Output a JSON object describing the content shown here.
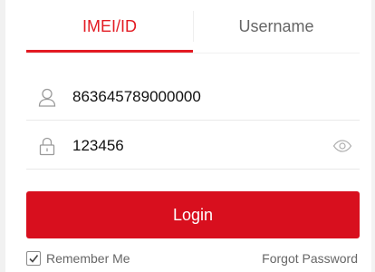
{
  "tabs": {
    "imei_label": "IMEI/ID",
    "username_label": "Username",
    "active": "IMEI/ID"
  },
  "imei_field": {
    "value": "863645789000000",
    "icon": "user-icon"
  },
  "password_field": {
    "value": "123456",
    "icon": "lock-icon",
    "toggle_icon": "eye-icon"
  },
  "login_button": {
    "label": "Login"
  },
  "remember_me": {
    "label": "Remember Me",
    "checked": true
  },
  "forgot_password": {
    "label": "Forgot Password"
  },
  "colors": {
    "accent": "#e31b23",
    "button": "#d80f1e",
    "muted_text": "#666666",
    "divider": "#e9e9e9"
  }
}
